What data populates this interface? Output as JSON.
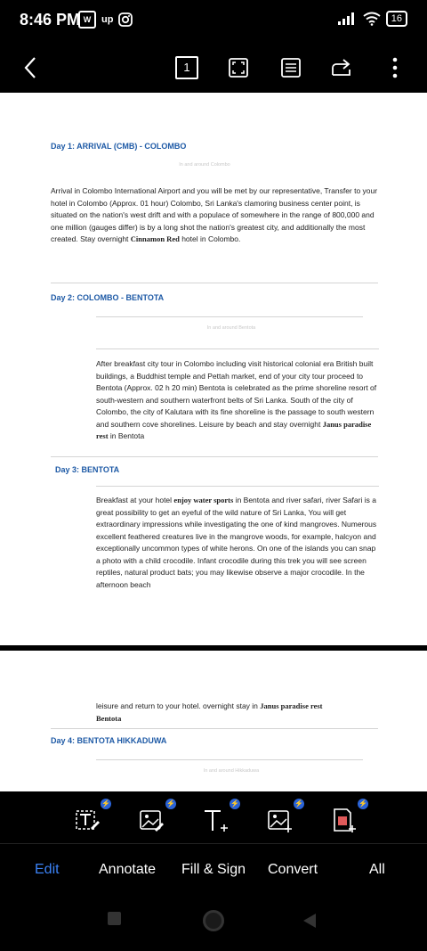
{
  "status": {
    "time": "8:46 PM",
    "app1": "W",
    "app2": "up",
    "battery": "16"
  },
  "toolbar": {
    "page_number": "1"
  },
  "doc": {
    "day1_title": "Day 1: ARRIVAL (CMB) - COLOMBO",
    "day1_sub": "In and around Colombo",
    "day1_text": "Arrival in Colombo International Airport and you will be met by our representative, Transfer to your hotel in Colombo (Approx. 01 hour) Colombo, Sri Lanka's clamoring business center point, is situated on the nation's west drift and with a populace of somewhere in the range of 800,000 and one million (gauges differ) is by a long shot the nation's greatest city, and additionally the most created. Stay overnight",
    "day1_bold": "Cinnamon Red",
    "day1_end": "hotel in Colombo.",
    "day2_title": "Day 2: COLOMBO - BENTOTA",
    "day2_sub": "In and around Bentota",
    "day2_text": "After breakfast city tour in Colombo including visit historical colonial era British built buildings, a Buddhist temple and Pettah market, end of your city tour proceed to Bentota (Approx. 02 h 20 min) Bentota is celebrated as the prime shoreline resort of south-western and southern waterfront belts of Sri Lanka. South of the city of Colombo, the city of Kalutara with its fine shoreline is the passage to south western and southern cove shorelines. Leisure by beach and stay overnight",
    "day2_bold": "Janus paradise rest",
    "day2_end": "in Bentota",
    "day3_title": "Day 3: BENTOTA",
    "day3_text_a": "Breakfast at your hotel",
    "day3_bold": "enjoy water sports",
    "day3_text_b": "in Bentota and river safari, river Safari is a great possibility to get an eyeful of the wild nature of Sri Lanka, You will get extraordinary impressions while investigating the one of kind mangroves. Numerous excellent feathered creatures live in the mangrove woods, for example, halcyon and exceptionally uncommon types of white herons. On one of the islands you can snap a photo with a child crocodile. Infant crocodile during this trek you will see screen reptiles, natural product bats; you may likewise observe a major crocodile. In the afternoon beach",
    "p2_text": "leisure and return to your hotel. overnight stay in",
    "p2_bold": "Janus paradise rest",
    "p2_bold2": "Bentota",
    "day4_title": "Day 4: BENTOTA HIKKADUWA",
    "day4_sub": "In and around Hikkaduwa"
  },
  "tabs": [
    "Edit",
    "Annotate",
    "Fill & Sign",
    "Convert",
    "All"
  ],
  "colors": {
    "accent": "#3b82f6",
    "heading": "#1e5aa6",
    "badge": "#2a63d8"
  }
}
